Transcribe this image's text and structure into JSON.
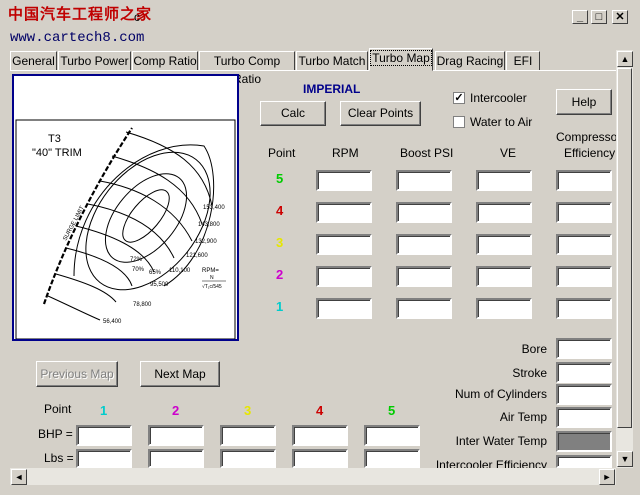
{
  "window": {
    "watermark_title": "中国汽车工程师之家",
    "app_title_fragment": "c",
    "watermark_url": "www.cartech8.com",
    "minimize": "_",
    "maximize": "□",
    "close": "✕"
  },
  "tabs": [
    {
      "label": "General"
    },
    {
      "label": "Turbo Power"
    },
    {
      "label": "Comp Ratio"
    },
    {
      "label": "Turbo Comp Ratio"
    },
    {
      "label": "Turbo Match"
    },
    {
      "label": "Turbo Map",
      "active": true
    },
    {
      "label": "Drag Racing"
    },
    {
      "label": "EFI"
    }
  ],
  "map": {
    "heading": "T3",
    "subheading": "\"40\" TRIM",
    "surge_label": "SURGE LIMIT",
    "speed_labels": [
      "153,400",
      "143,800",
      "132,900",
      "121,600",
      "110,100",
      "95,500",
      "78,800",
      "56,400"
    ],
    "efficiency_labels": [
      "72%",
      "70%",
      "65%"
    ],
    "formula_label": "RPM=",
    "formula_sub": "N",
    "formula_den": "√T₁c/545"
  },
  "controls": {
    "units_label": "IMPERIAL",
    "calc_button": "Calc",
    "clear_button": "Clear Points",
    "intercooler_label": "Intercooler",
    "intercooler_checked": true,
    "water_to_air_label": "Water to Air",
    "water_to_air_checked": false,
    "help_button": "Help"
  },
  "grid": {
    "headers": {
      "point": "Point",
      "rpm": "RPM",
      "boost": "Boost PSI",
      "ve": "VE",
      "comp1": "Compressor",
      "comp2": "Efficiency"
    },
    "rows": [
      {
        "point": "5",
        "color": "#00cc00"
      },
      {
        "point": "4",
        "color": "#cc0000"
      },
      {
        "point": "3",
        "color": "#e6e600"
      },
      {
        "point": "2",
        "color": "#cc00cc"
      },
      {
        "point": "1",
        "color": "#00cccc"
      }
    ]
  },
  "engine_fields": {
    "bore": "Bore",
    "stroke": "Stroke",
    "cylinders": "Num of Cylinders",
    "air_temp": "Air Temp",
    "inter_water_temp": "Inter Water Temp",
    "intercooler_eff": "Intercooler Efficiency"
  },
  "nav": {
    "previous": "Previous Map",
    "next": "Next Map"
  },
  "bottom": {
    "point_label": "Point",
    "points": [
      {
        "label": "1",
        "color": "#00cccc"
      },
      {
        "label": "2",
        "color": "#cc00cc"
      },
      {
        "label": "3",
        "color": "#e6e600"
      },
      {
        "label": "4",
        "color": "#cc0000"
      },
      {
        "label": "5",
        "color": "#00cc00"
      }
    ],
    "bhp_label": "BHP =",
    "lbs_label": "Lbs ="
  },
  "scrollbar": {
    "up": "▲",
    "down": "▼",
    "left": "◄",
    "right": "►"
  }
}
